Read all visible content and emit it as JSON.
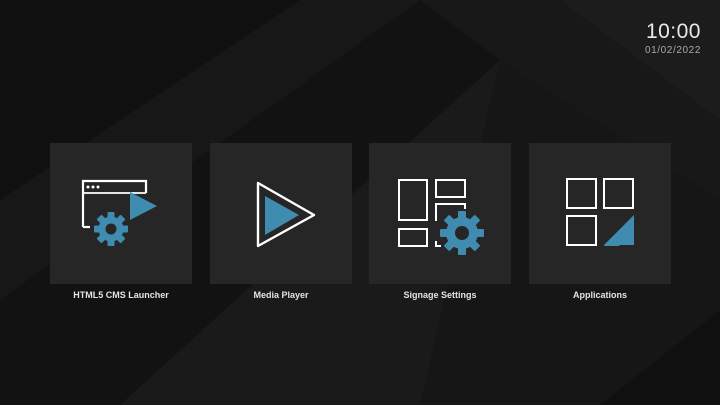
{
  "clock": {
    "time": "10:00",
    "date": "01/02/2022"
  },
  "colors": {
    "accent": "#3f8cb0",
    "tile_background": "#262626",
    "screen_background": "#141414",
    "icon_stroke": "#ffffff"
  },
  "tiles": [
    {
      "label": "HTML5 CMS Launcher",
      "icon": "html5-launcher-icon"
    },
    {
      "label": "Media Player",
      "icon": "play-icon"
    },
    {
      "label": "Signage Settings",
      "icon": "signage-settings-icon"
    },
    {
      "label": "Applications",
      "icon": "applications-grid-icon"
    }
  ]
}
